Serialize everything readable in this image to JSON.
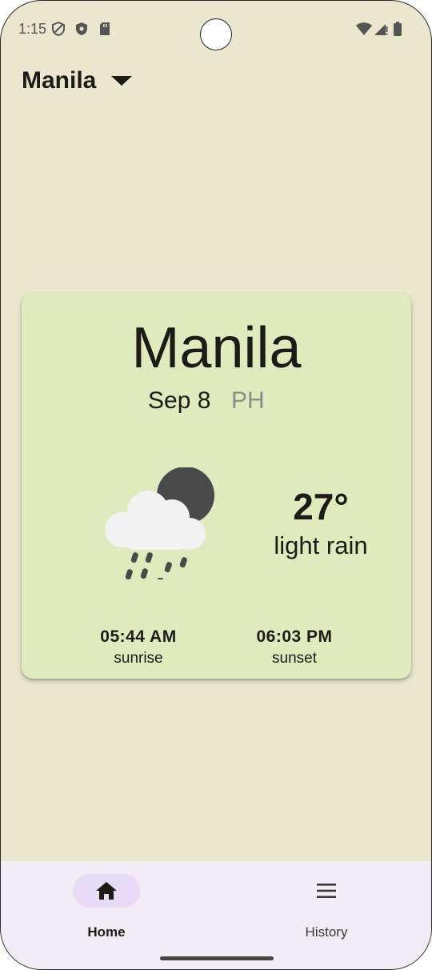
{
  "status_bar": {
    "time": "1:15"
  },
  "header": {
    "selected_city": "Manila"
  },
  "weather_card": {
    "city": "Manila",
    "date": "Sep 8",
    "country": "PH",
    "temperature": "27°",
    "description": "light rain",
    "sunrise_time": "05:44 AM",
    "sunrise_label": "sunrise",
    "sunset_time": "06:03 PM",
    "sunset_label": "sunset",
    "icon": "cloud-rain-moon-icon"
  },
  "bottom_nav": {
    "items": [
      {
        "label": "Home",
        "icon": "home-icon",
        "active": true
      },
      {
        "label": "History",
        "icon": "menu-icon",
        "active": false
      }
    ]
  },
  "colors": {
    "background": "#ebe7cf",
    "card": "#dfeabd",
    "nav_background": "#f1ecf6",
    "active_pill": "#e6dcf7"
  }
}
